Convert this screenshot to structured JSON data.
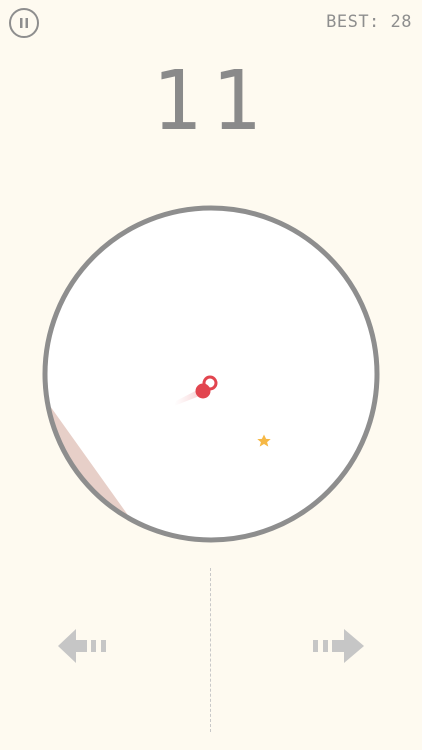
{
  "hud": {
    "best_label": "BEST: 28",
    "score": "11",
    "pause_icon": "pause-icon"
  },
  "game": {
    "stars_visible": 1,
    "ring_color": "#8E8E8E",
    "ball_color": "#E2454F",
    "star_color": "#F6B845",
    "paddle_color": "#E7CFC8",
    "background_color": "#FEFAF0"
  },
  "controls": {
    "left_icon": "arrow-left-icon",
    "right_icon": "arrow-right-icon",
    "arrow_color": "#C6C6C6"
  }
}
